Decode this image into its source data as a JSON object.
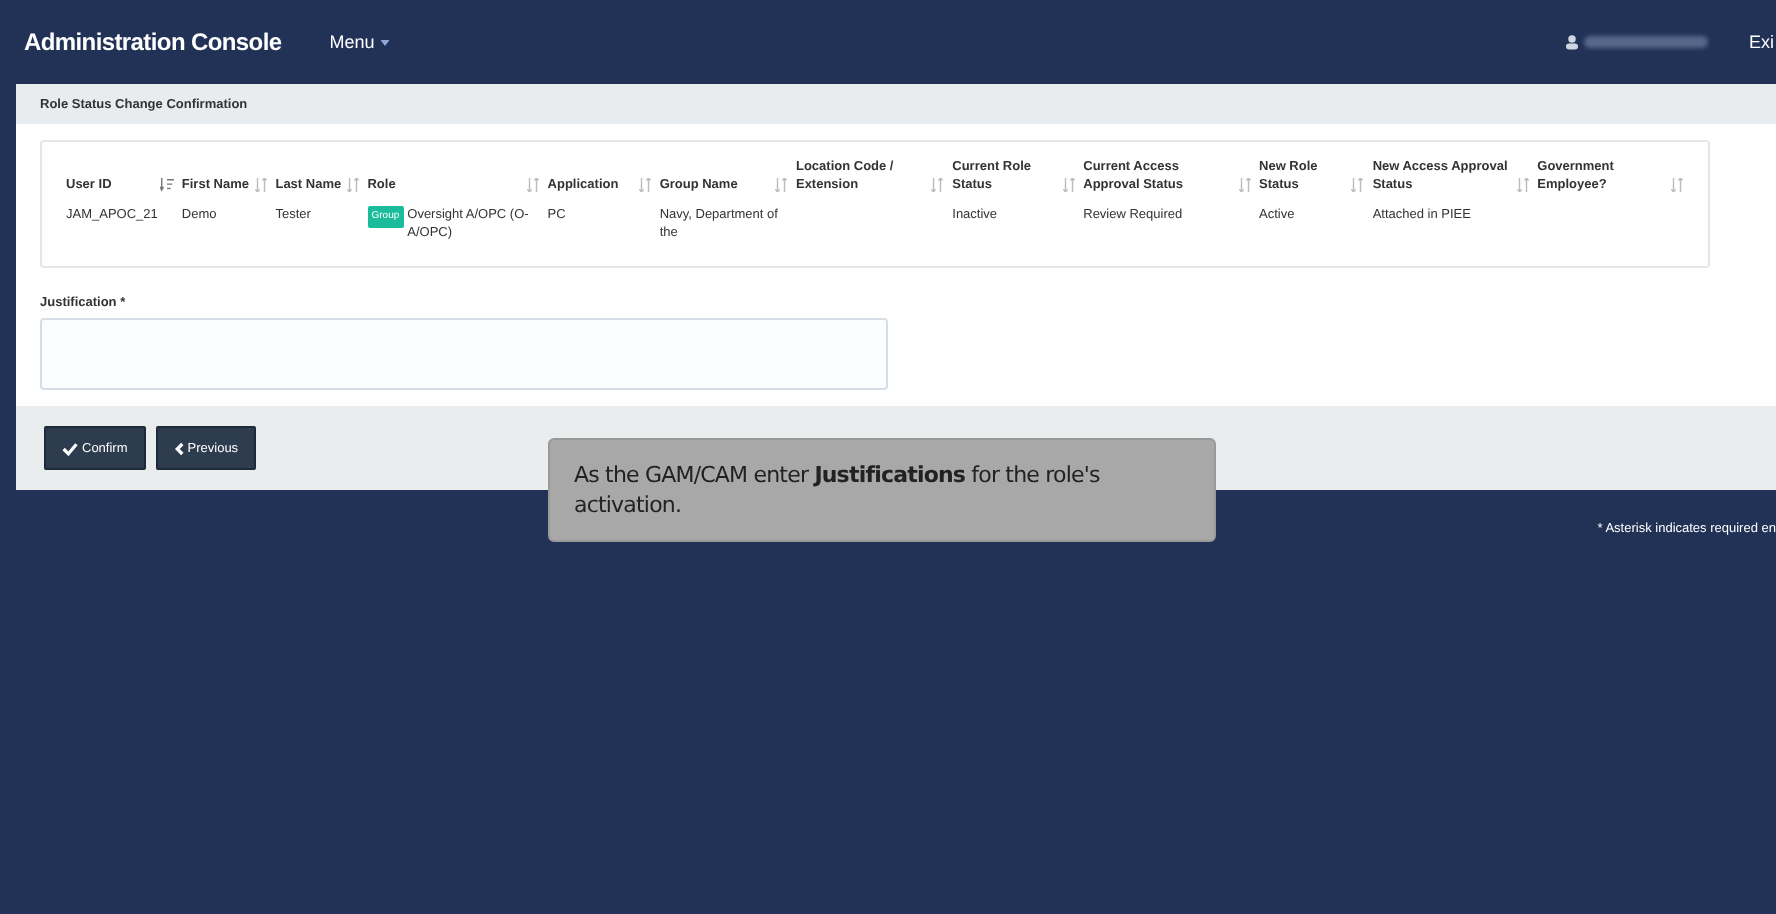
{
  "navbar": {
    "brand": "Administration Console",
    "menu": "Menu",
    "exit": "Exi"
  },
  "panel": {
    "title": "Role Status Change Confirmation"
  },
  "table": {
    "columns": [
      {
        "label": "User ID",
        "sorted": true
      },
      {
        "label": "First Name",
        "sorted": false
      },
      {
        "label": "Last Name",
        "sorted": false
      },
      {
        "label": "Role",
        "sorted": false
      },
      {
        "label": "Application",
        "sorted": false
      },
      {
        "label": "Group Name",
        "sorted": false
      },
      {
        "label": "Location Code / Extension",
        "sorted": false
      },
      {
        "label": "Current Role Status",
        "sorted": false
      },
      {
        "label": "Current Access Approval Status",
        "sorted": false
      },
      {
        "label": "New Role Status",
        "sorted": false
      },
      {
        "label": "New Access Approval Status",
        "sorted": false
      },
      {
        "label": "Government Employee?",
        "sorted": false
      }
    ],
    "rows": [
      {
        "cells": [
          "JAM_APOC_21",
          "Demo",
          "Tester",
          {
            "badge": "Group",
            "text": "Oversight A/OPC (O-A/OPC)"
          },
          "PC",
          "Navy, Department of the",
          "",
          "Inactive",
          "Review Required",
          "Active",
          "Attached in PIEE",
          ""
        ]
      }
    ]
  },
  "justification": {
    "label": "Justification *"
  },
  "buttons": [
    {
      "kind": "confirm",
      "label": "Confirm"
    },
    {
      "kind": "previous",
      "label": "Previous"
    }
  ],
  "tooltip": "As the GAM/CAM enter **Justifications** for the role's activation.",
  "footnote": "* Asterisk indicates required en"
}
